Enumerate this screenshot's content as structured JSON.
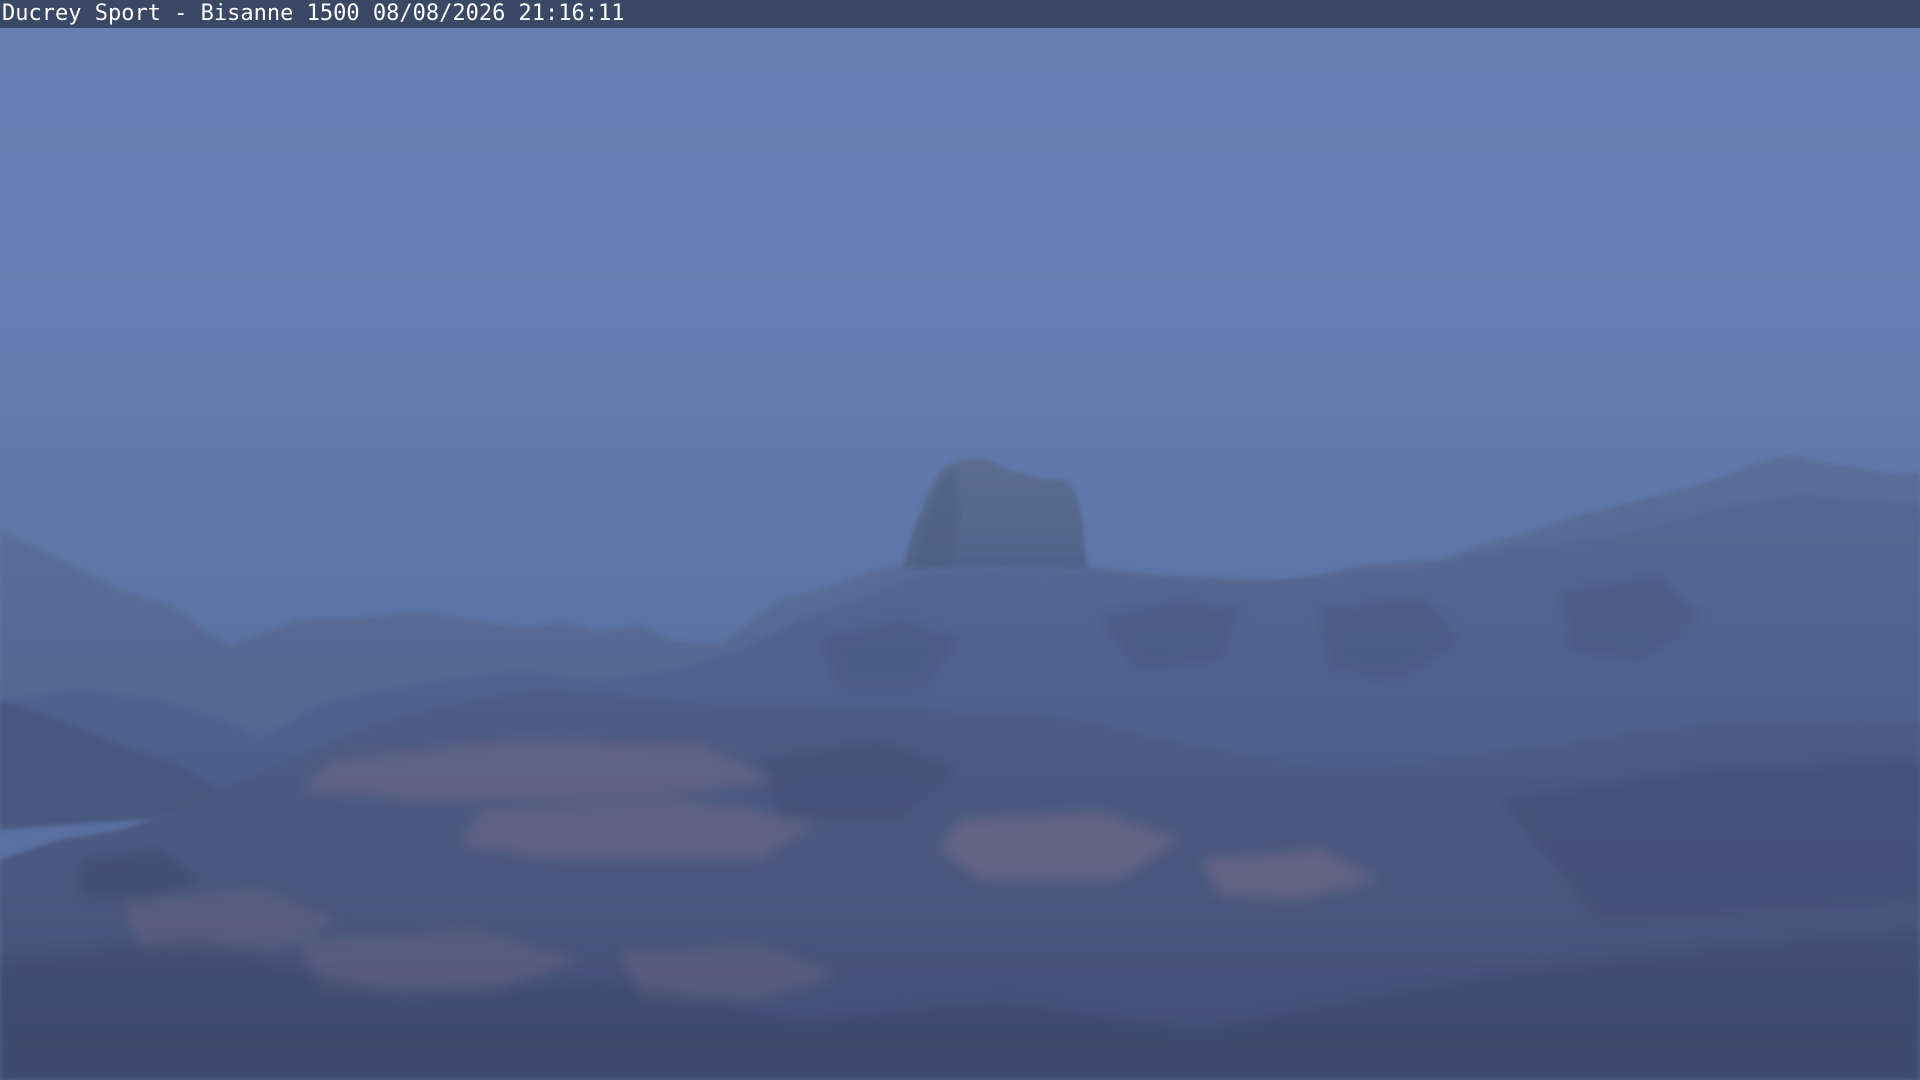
{
  "camera": {
    "overlay_text": "Ducrey Sport - Bisanne 1500 08/08/2026 21:16:11"
  },
  "colors": {
    "sky_top": "#6680b6",
    "sky_bottom": "#566c9c",
    "far_range": "#54678f",
    "peak": "#566787",
    "mid_range": "#4e6088",
    "near_slope": "#48557b",
    "rock_bands": "#7a6c86",
    "overlay_bar": "#3a4866",
    "overlay_text": "#ffffff"
  }
}
